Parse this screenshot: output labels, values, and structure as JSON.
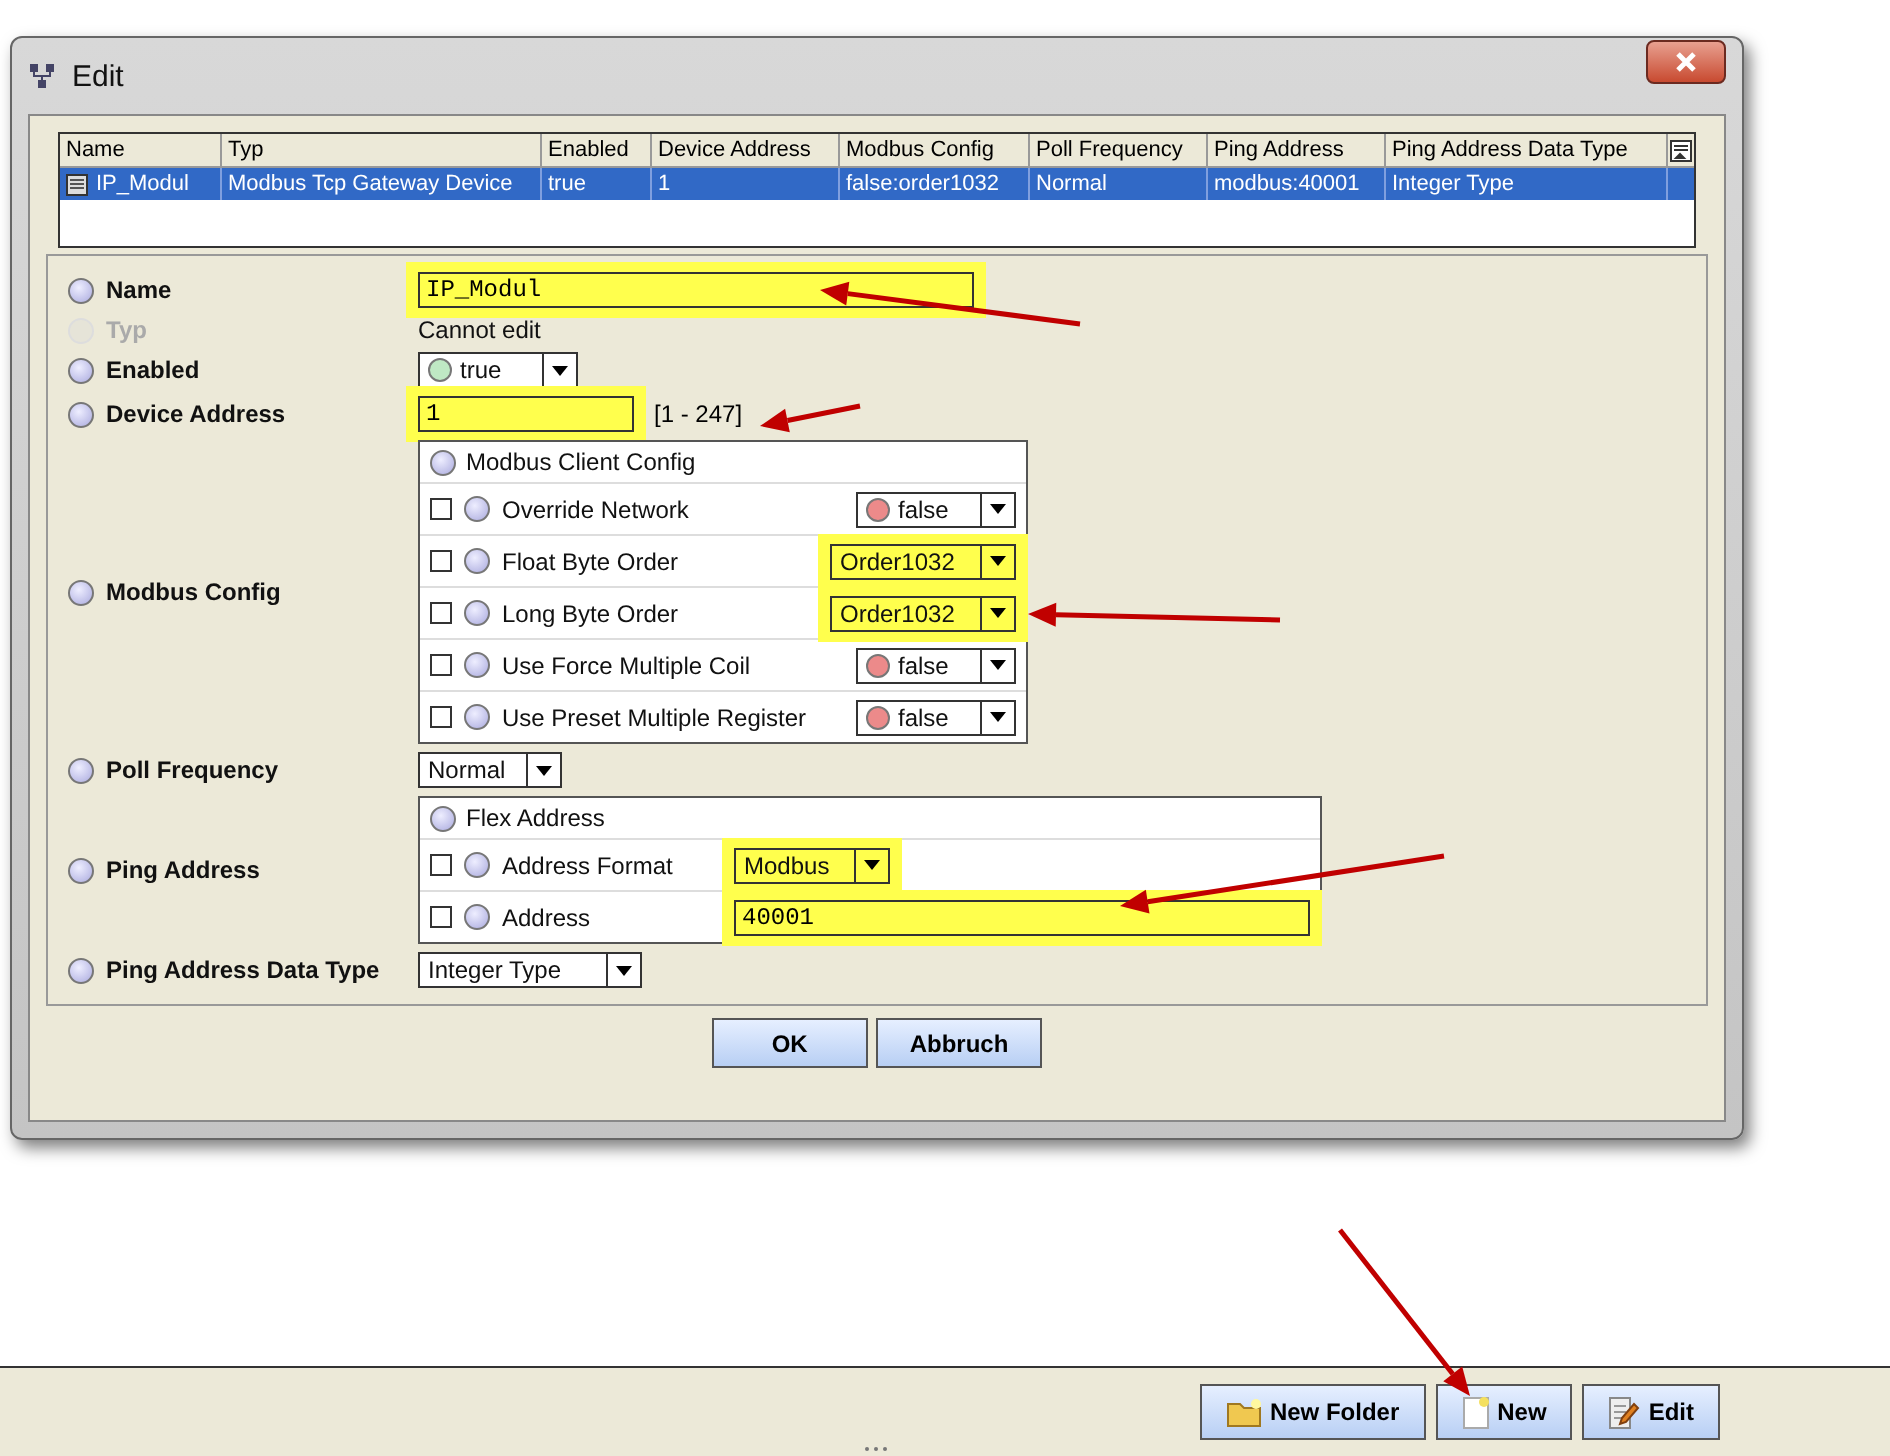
{
  "window": {
    "title": "Edit"
  },
  "table": {
    "columns": [
      "Name",
      "Typ",
      "Enabled",
      "Device Address",
      "Modbus Config",
      "Poll Frequency",
      "Ping Address",
      "Ping Address Data Type"
    ],
    "rows": [
      {
        "cells": [
          "IP_Modul",
          "Modbus Tcp Gateway Device",
          "true",
          "1",
          "false:order1032",
          "Normal",
          "modbus:40001",
          "Integer Type"
        ],
        "selected": true
      }
    ]
  },
  "form": {
    "fields": [
      {
        "kind": "text",
        "label": "Name",
        "value": "IP_Modul",
        "highlighted": true,
        "disabled": false
      },
      {
        "kind": "readonly",
        "label": "Typ",
        "value": "Cannot edit",
        "highlighted": false,
        "disabled": true
      },
      {
        "kind": "bool",
        "label": "Enabled",
        "value": "true",
        "on": true,
        "highlighted": false,
        "disabled": false
      },
      {
        "kind": "range",
        "label": "Device Address",
        "value": "1",
        "range": "[1 - 247]",
        "highlighted": true,
        "disabled": false
      },
      {
        "kind": "group",
        "label": "Modbus Config",
        "title": "Modbus Client Config",
        "highlighted": false,
        "disabled": false,
        "items": [
          {
            "kind": "bool",
            "label": "Override Network",
            "value": "false",
            "on": false,
            "checked": false,
            "highlighted": false
          },
          {
            "kind": "select",
            "label": "Float Byte Order",
            "value": "Order1032",
            "checked": false,
            "highlighted": true
          },
          {
            "kind": "select",
            "label": "Long Byte Order",
            "value": "Order1032",
            "checked": false,
            "highlighted": true
          },
          {
            "kind": "bool",
            "label": "Use Force Multiple Coil",
            "value": "false",
            "on": false,
            "checked": false,
            "highlighted": false
          },
          {
            "kind": "bool",
            "label": "Use Preset Multiple Register",
            "value": "false",
            "on": false,
            "checked": false,
            "highlighted": false
          }
        ]
      },
      {
        "kind": "select",
        "label": "Poll Frequency",
        "value": "Normal",
        "highlighted": false,
        "disabled": false
      },
      {
        "kind": "group",
        "label": "Ping Address",
        "title": "Flex Address",
        "highlighted": false,
        "disabled": false,
        "items": [
          {
            "kind": "select",
            "label": "Address Format",
            "value": "Modbus",
            "checked": false,
            "highlighted": true
          },
          {
            "kind": "text",
            "label": "Address",
            "value": "40001",
            "checked": false,
            "highlighted": true
          }
        ]
      },
      {
        "kind": "select",
        "label": "Ping Address Data Type",
        "value": "Integer Type",
        "highlighted": false,
        "disabled": false
      }
    ]
  },
  "buttons": [
    "OK",
    "Abbruch"
  ],
  "toolbar": {
    "buttons": [
      {
        "kind": "folder",
        "label": "New Folder"
      },
      {
        "kind": "new",
        "label": "New"
      },
      {
        "kind": "edit",
        "label": "Edit"
      }
    ]
  }
}
